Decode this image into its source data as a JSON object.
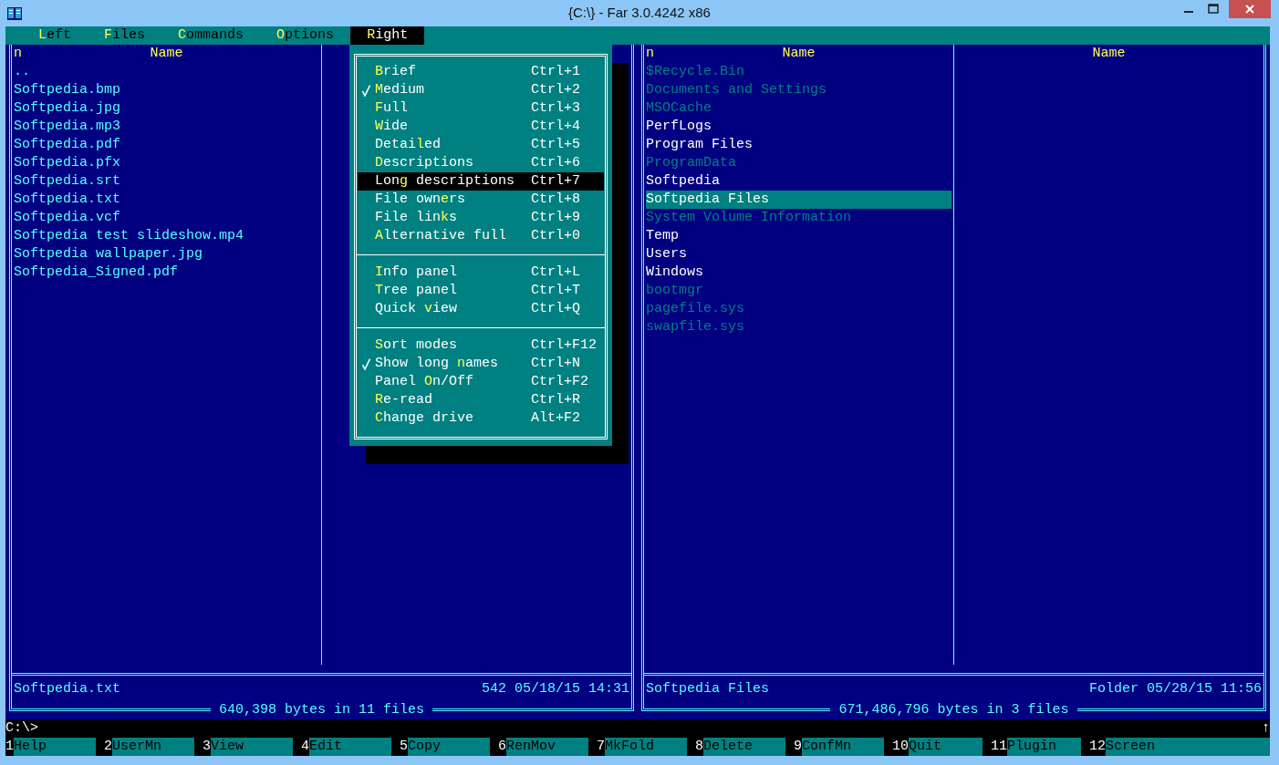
{
  "window": {
    "title": "{C:\\} - Far 3.0.4242 x86"
  },
  "menu_bar": [
    {
      "key": "L",
      "rest": "eft",
      "selected": false
    },
    {
      "key": "F",
      "rest": "iles",
      "selected": false
    },
    {
      "key": "C",
      "rest": "ommands",
      "selected": false
    },
    {
      "key": "O",
      "rest": "ptions",
      "selected": false
    },
    {
      "key": "R",
      "rest": "ight",
      "selected": true
    }
  ],
  "dropdown_menu": {
    "sections": [
      {
        "items": [
          {
            "key": "B",
            "after": "rief",
            "shortcut": "Ctrl+1",
            "checked": false,
            "selected": false
          },
          {
            "key": "M",
            "after": "edium",
            "shortcut": "Ctrl+2",
            "checked": true,
            "selected": false
          },
          {
            "key": "F",
            "after": "ull",
            "shortcut": "Ctrl+3",
            "checked": false,
            "selected": false
          },
          {
            "key": "W",
            "after": "ide",
            "shortcut": "Ctrl+4",
            "checked": false,
            "selected": false
          },
          {
            "before": "Detai",
            "key": "l",
            "after": "ed",
            "shortcut": "Ctrl+5",
            "checked": false,
            "selected": false
          },
          {
            "key": "D",
            "after": "escriptions",
            "shortcut": "Ctrl+6",
            "checked": false,
            "selected": false
          },
          {
            "before": "Lon",
            "key": "g",
            "after": " descriptions",
            "shortcut": "Ctrl+7",
            "checked": false,
            "selected": true
          },
          {
            "before": "File own",
            "key": "e",
            "after": "rs",
            "shortcut": "Ctrl+8",
            "checked": false,
            "selected": false
          },
          {
            "before": "File lin",
            "key": "k",
            "after": "s",
            "shortcut": "Ctrl+9",
            "checked": false,
            "selected": false
          },
          {
            "key": "A",
            "after": "lternative full",
            "shortcut": "Ctrl+0",
            "checked": false,
            "selected": false
          }
        ]
      },
      {
        "items": [
          {
            "key": "I",
            "after": "nfo panel",
            "shortcut": "Ctrl+L",
            "checked": false,
            "selected": false
          },
          {
            "key": "T",
            "after": "ree panel",
            "shortcut": "Ctrl+T",
            "checked": false,
            "selected": false
          },
          {
            "before": "Quick ",
            "key": "v",
            "after": "iew",
            "shortcut": "Ctrl+Q",
            "checked": false,
            "selected": false
          }
        ]
      },
      {
        "items": [
          {
            "key": "S",
            "after": "ort modes",
            "shortcut": "Ctrl+F12",
            "checked": false,
            "selected": false
          },
          {
            "before": "Show long ",
            "key": "n",
            "after": "ames",
            "shortcut": "Ctrl+N",
            "checked": true,
            "selected": false
          },
          {
            "before": "Panel ",
            "key": "O",
            "after": "n/Off",
            "shortcut": "Ctrl+F2",
            "checked": false,
            "selected": false
          },
          {
            "key": "R",
            "after": "e-read",
            "shortcut": "Ctrl+R",
            "checked": false,
            "selected": false
          },
          {
            "key": "C",
            "after": "hange drive",
            "shortcut": "Alt+F2",
            "checked": false,
            "selected": false
          }
        ]
      }
    ]
  },
  "panels": [
    {
      "columns": [
        {
          "sort_mark": "n",
          "header": "Name"
        }
      ],
      "files": [
        {
          "name": "..",
          "kind": "file",
          "selected": false
        },
        {
          "name": "Softpedia.bmp",
          "kind": "file",
          "selected": false
        },
        {
          "name": "Softpedia.jpg",
          "kind": "file",
          "selected": false
        },
        {
          "name": "Softpedia.mp3",
          "kind": "file",
          "selected": false
        },
        {
          "name": "Softpedia.pdf",
          "kind": "file",
          "selected": false
        },
        {
          "name": "Softpedia.pfx",
          "kind": "file",
          "selected": false
        },
        {
          "name": "Softpedia.srt",
          "kind": "file",
          "selected": false
        },
        {
          "name": "Softpedia.txt",
          "kind": "file",
          "selected": false
        },
        {
          "name": "Softpedia.vcf",
          "kind": "file",
          "selected": false
        },
        {
          "name": "Softpedia test slideshow.mp4",
          "kind": "file",
          "selected": false
        },
        {
          "name": "Softpedia wallpaper.jpg",
          "kind": "file",
          "selected": false
        },
        {
          "name": "Softpedia_Signed.pdf",
          "kind": "file",
          "selected": false
        }
      ],
      "status": {
        "name": "Softpedia.txt",
        "info": "542 05/18/15 14:31"
      },
      "totals": "640,398 bytes in 11 files"
    },
    {
      "columns": [
        {
          "sort_mark": "n",
          "header": "Name"
        },
        {
          "header": "Name"
        }
      ],
      "files": [
        {
          "name": "$Recycle.Bin",
          "kind": "hidden",
          "selected": false
        },
        {
          "name": "Documents and Settings",
          "kind": "hidden",
          "selected": false
        },
        {
          "name": "MSOCache",
          "kind": "hidden",
          "selected": false
        },
        {
          "name": "PerfLogs",
          "kind": "folder",
          "selected": false
        },
        {
          "name": "Program Files",
          "kind": "folder",
          "selected": false
        },
        {
          "name": "ProgramData",
          "kind": "hidden",
          "selected": false
        },
        {
          "name": "Softpedia",
          "kind": "folder",
          "selected": false
        },
        {
          "name": "Softpedia Files",
          "kind": "folder",
          "selected": true
        },
        {
          "name": "System Volume Information",
          "kind": "hidden",
          "selected": false
        },
        {
          "name": "Temp",
          "kind": "folder",
          "selected": false
        },
        {
          "name": "Users",
          "kind": "folder",
          "selected": false
        },
        {
          "name": "Windows",
          "kind": "folder",
          "selected": false
        },
        {
          "name": "bootmgr",
          "kind": "hidden",
          "selected": false
        },
        {
          "name": "pagefile.sys",
          "kind": "hidden",
          "selected": false
        },
        {
          "name": "swapfile.sys",
          "kind": "hidden",
          "selected": false
        }
      ],
      "status": {
        "name": "Softpedia Files",
        "info": "Folder 05/28/15 11:56"
      },
      "totals": "671,486,796 bytes in 3 files"
    }
  ],
  "command_line": {
    "prompt": "C:\\>",
    "scroll_mark": "↑"
  },
  "key_bar": [
    {
      "key": "1",
      "label": "Help"
    },
    {
      "key": "2",
      "label": "UserMn"
    },
    {
      "key": "3",
      "label": "View"
    },
    {
      "key": "4",
      "label": "Edit"
    },
    {
      "key": "5",
      "label": "Copy"
    },
    {
      "key": "6",
      "label": "RenMov"
    },
    {
      "key": "7",
      "label": "MkFold"
    },
    {
      "key": "8",
      "label": "Delete"
    },
    {
      "key": "9",
      "label": "ConfMn"
    },
    {
      "key": "10",
      "label": "Quit"
    },
    {
      "key": "11",
      "label": "Plugin"
    },
    {
      "key": "12",
      "label": "Screen"
    }
  ]
}
